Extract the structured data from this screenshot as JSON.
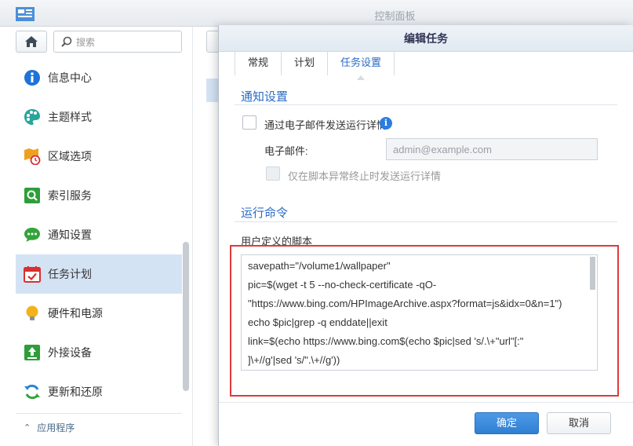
{
  "window": {
    "title": "控制面板"
  },
  "search": {
    "placeholder": "搜索"
  },
  "sidebar": {
    "items": [
      {
        "label": "信息中心",
        "icon": "info-icon",
        "color": "#1e73d8"
      },
      {
        "label": "主题样式",
        "icon": "palette-icon",
        "color": "#2aa59a"
      },
      {
        "label": "区域选项",
        "icon": "regional-clock-icon",
        "color": "#f0a020"
      },
      {
        "label": "索引服务",
        "icon": "index-search-icon",
        "color": "#2e9e3a"
      },
      {
        "label": "通知设置",
        "icon": "notification-chat-icon",
        "color": "#33a43a"
      },
      {
        "label": "任务计划",
        "icon": "calendar-check-icon",
        "color": "#d93030"
      },
      {
        "label": "硬件和电源",
        "icon": "lightbulb-icon",
        "color": "#f2b21a"
      },
      {
        "label": "外接设备",
        "icon": "external-device-icon",
        "color": "#2e9e3a"
      },
      {
        "label": "更新和还原",
        "icon": "update-restore-icon",
        "color": "#2a86d6"
      }
    ],
    "active_index": 5,
    "section_label": "应用程序"
  },
  "dialog": {
    "title": "编辑任务",
    "tabs": [
      {
        "label": "常规"
      },
      {
        "label": "计划"
      },
      {
        "label": "任务设置"
      }
    ],
    "active_tab": 2,
    "notify": {
      "section_title": "通知设置",
      "email_checkbox_label": "通过电子邮件发送运行详情",
      "email_checked": false,
      "email_label": "电子邮件:",
      "email_placeholder": "admin@example.com",
      "abnormal_checkbox_label": "仅在脚本异常终止时发送运行详情",
      "abnormal_checked": false
    },
    "command": {
      "section_title": "运行命令",
      "script_label": "用户定义的脚本",
      "script_lines": [
        "savepath=\"/volume1/wallpaper\"",
        "pic=$(wget -t 5 --no-check-certificate -qO-",
        "\"https://www.bing.com/HPImageArchive.aspx?format=js&idx=0&n=1\")",
        "echo $pic|grep -q enddate||exit",
        "link=$(echo https://www.bing.com$(echo $pic|sed 's/.\\+\"url\"[:\"",
        "]\\+//g'|sed 's/\".\\+//g'))"
      ]
    },
    "buttons": {
      "ok": "确定",
      "cancel": "取消"
    },
    "highlight_color": "#e03a3a"
  }
}
